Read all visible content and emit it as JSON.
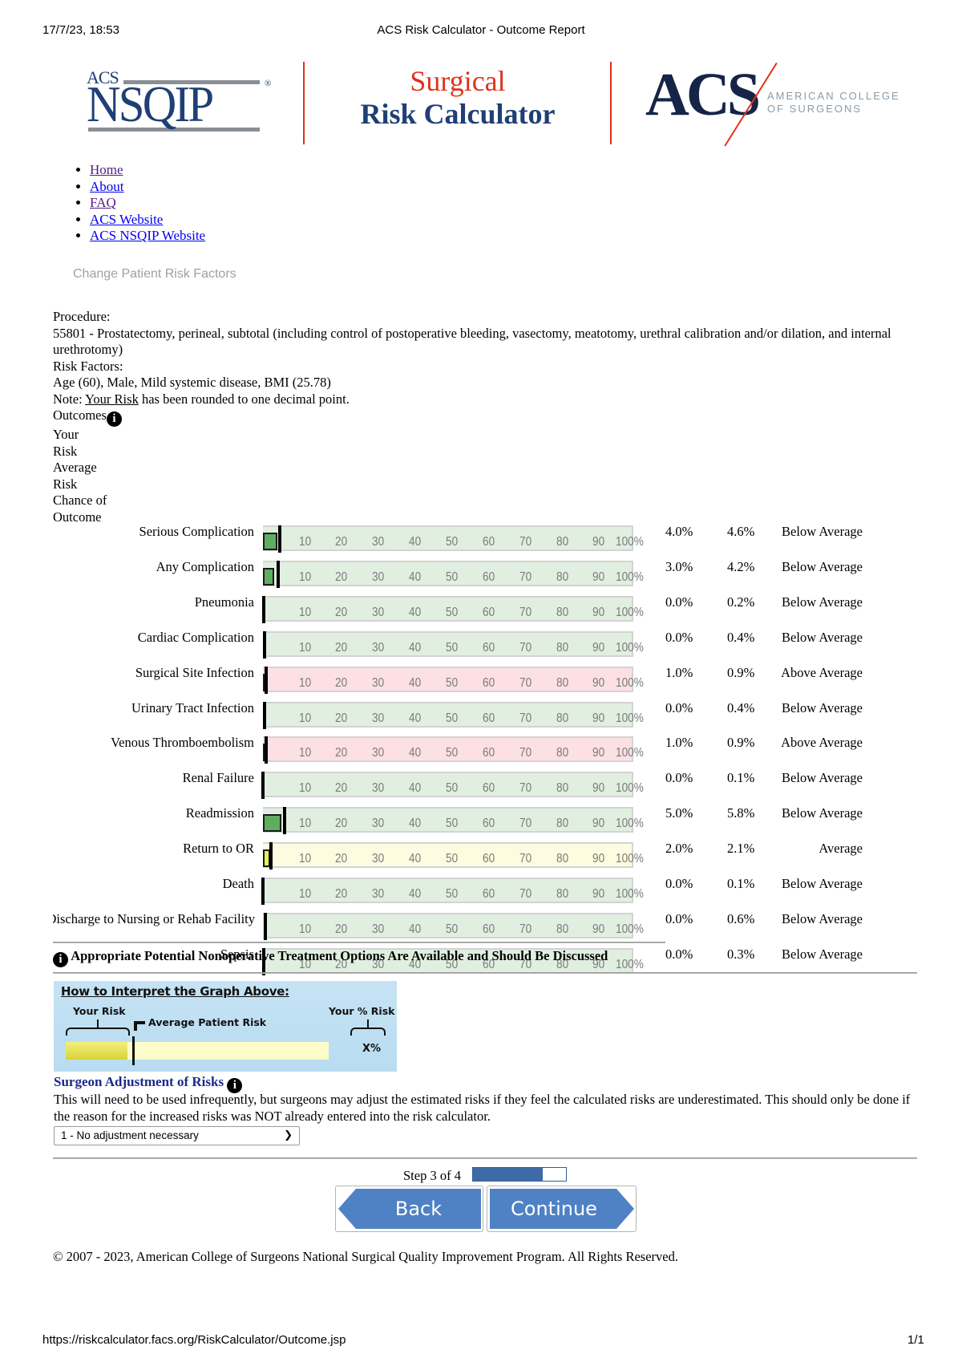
{
  "print_header": {
    "datetime": "17/7/23, 18:53",
    "page_title": "ACS Risk Calculator - Outcome Report"
  },
  "logos": {
    "nsqip_small": "ACS",
    "nsqip_big": "NSQIP",
    "nsqip_reg": "®",
    "title_line1": "Surgical",
    "title_line2": "Risk Calculator",
    "acs_big": "ACS",
    "acs_sub_line1": "AMERICAN COLLEGE",
    "acs_sub_line2": "OF SURGEONS"
  },
  "nav": [
    {
      "label": "Home",
      "visited": true
    },
    {
      "label": "About",
      "visited": false
    },
    {
      "label": "FAQ",
      "visited": true
    },
    {
      "label": "ACS Website",
      "visited": false
    },
    {
      "label": "ACS NSQIP Website",
      "visited": false
    }
  ],
  "change_link": "Change Patient Risk Factors",
  "procedure": {
    "label": "Procedure:",
    "text": "55801 - Prostatectomy, perineal, subtotal (including control of postoperative bleeding, vasectomy, meatotomy, urethral calibration and/or dilation, and internal urethrotomy)"
  },
  "risk_factors": {
    "label": "Risk Factors:",
    "text": "Age (60), Male, Mild systemic disease, BMI (25.78)"
  },
  "note": {
    "prefix": "Note: ",
    "link": "Your Risk",
    "suffix": " has been rounded to one decimal point."
  },
  "outcomes_header": {
    "title": "Outcomes",
    "info_icon": "i",
    "col_lines": [
      "Your",
      "Risk",
      "Average",
      "Risk",
      "Chance of",
      "Outcome"
    ]
  },
  "chart_data": {
    "type": "bar",
    "title": "Outcomes",
    "xlabel": "",
    "ylabel": "",
    "ylim": [
      0,
      100
    ],
    "ticks": [
      "10",
      "20",
      "30",
      "40",
      "50",
      "60",
      "70",
      "80",
      "90",
      "100%"
    ],
    "categories": [
      "Serious Complication",
      "Any Complication",
      "Pneumonia",
      "Cardiac Complication",
      "Surgical Site Infection",
      "Urinary Tract Infection",
      "Venous Thromboembolism",
      "Renal Failure",
      "Readmission",
      "Return to OR",
      "Death",
      "Discharge to Nursing or Rehab Facility",
      "Sepsis"
    ],
    "series": [
      {
        "name": "Your Risk",
        "values": [
          4.0,
          3.0,
          0.0,
          0.0,
          1.0,
          0.0,
          1.0,
          0.0,
          5.0,
          2.0,
          0.0,
          0.0,
          0.0
        ]
      },
      {
        "name": "Average Risk",
        "values": [
          4.6,
          4.2,
          0.2,
          0.4,
          0.9,
          0.4,
          0.9,
          0.1,
          5.8,
          2.1,
          0.1,
          0.6,
          0.3
        ]
      }
    ],
    "rows": [
      {
        "label": "Serious Complication",
        "your": "4.0%",
        "avg": "4.6%",
        "chance": "Below Average",
        "color": "green"
      },
      {
        "label": "Any Complication",
        "your": "3.0%",
        "avg": "4.2%",
        "chance": "Below Average",
        "color": "green"
      },
      {
        "label": "Pneumonia",
        "your": "0.0%",
        "avg": "0.2%",
        "chance": "Below Average",
        "color": "green"
      },
      {
        "label": "Cardiac Complication",
        "your": "0.0%",
        "avg": "0.4%",
        "chance": "Below Average",
        "color": "green"
      },
      {
        "label": "Surgical Site Infection",
        "your": "1.0%",
        "avg": "0.9%",
        "chance": "Above Average",
        "color": "red"
      },
      {
        "label": "Urinary Tract Infection",
        "your": "0.0%",
        "avg": "0.4%",
        "chance": "Below Average",
        "color": "green"
      },
      {
        "label": "Venous Thromboembolism",
        "your": "1.0%",
        "avg": "0.9%",
        "chance": "Above Average",
        "color": "red"
      },
      {
        "label": "Renal Failure",
        "your": "0.0%",
        "avg": "0.1%",
        "chance": "Below Average",
        "color": "green"
      },
      {
        "label": "Readmission",
        "your": "5.0%",
        "avg": "5.8%",
        "chance": "Below Average",
        "color": "green"
      },
      {
        "label": "Return to OR",
        "your": "2.0%",
        "avg": "2.1%",
        "chance": "Average",
        "color": "yellow"
      },
      {
        "label": "Death",
        "your": "0.0%",
        "avg": "0.1%",
        "chance": "Below Average",
        "color": "green"
      },
      {
        "label": "Discharge to Nursing or Rehab Facility",
        "your": "0.0%",
        "avg": "0.6%",
        "chance": "Below Average",
        "color": "green"
      },
      {
        "label": "Sepsis",
        "your": "0.0%",
        "avg": "0.3%",
        "chance": "Below Average",
        "color": "green"
      }
    ],
    "colors": {
      "green_fill": "#5fae5f",
      "green_track": "#e1efe0",
      "red_fill": "#d9404f",
      "red_track": "#fde0e3",
      "yellow_fill": "#ecec55",
      "yellow_track": "#fdfce0"
    }
  },
  "banner": {
    "icon": "i",
    "text": "Appropriate Potential Nonoperative Treatment Options Are Available and Should Be Discussed"
  },
  "interpret": {
    "title": "How to Interpret the Graph Above:",
    "your_risk": "Your Risk",
    "average_patient_risk": "Average Patient Risk",
    "your_pct_risk": "Your % Risk",
    "x_pct": "X%"
  },
  "adjustment": {
    "title": "Surgeon Adjustment of Risks",
    "info_icon": "i",
    "text": "This will need to be used infrequently, but surgeons may adjust the estimated risks if they feel the calculated risks are underestimated. This should only be done if the reason for the increased risks was NOT already entered into the risk calculator.",
    "selected": "1 - No adjustment necessary"
  },
  "progress": {
    "label": "Step 3 of 4",
    "fraction": 0.75
  },
  "buttons": {
    "back": "Back",
    "continue": "Continue"
  },
  "footer": "© 2007 - 2023, American College of Surgeons National Surgical Quality Improvement Program. All Rights Reserved.",
  "print_footer": {
    "url": "https://riskcalculator.facs.org/RiskCalculator/Outcome.jsp",
    "page": "1/1"
  }
}
